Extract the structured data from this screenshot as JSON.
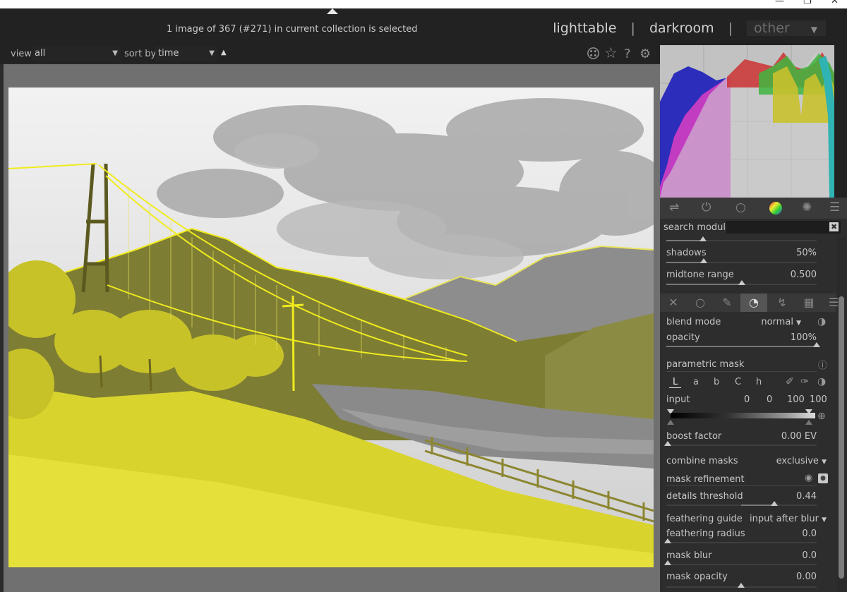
{
  "window": {
    "minimize": "—",
    "maximize": "❐",
    "close": "✕"
  },
  "header": {
    "selection_status": "1 image of 367 (#271) in current collection is selected",
    "views": {
      "lighttable": "lighttable",
      "darkroom": "darkroom",
      "other": "other",
      "separator": "|"
    }
  },
  "filterbar": {
    "view_label": "view",
    "view_value": "all",
    "sort_label": "sort by",
    "sort_value": "time",
    "sort_direction": "▲"
  },
  "modules": {
    "search_label": "search module",
    "search_value": ""
  },
  "tone_params": [
    {
      "label": "shadows",
      "value": "50%",
      "level": 0.25
    },
    {
      "label": "midtone range",
      "value": "0.500",
      "level": 0.5
    }
  ],
  "blend": {
    "mode_label": "blend mode",
    "mode_value": "normal",
    "opacity_label": "opacity",
    "opacity_value": "100%",
    "opacity_level": 1.0,
    "parametric_label": "parametric mask",
    "channels": [
      "L",
      "a",
      "b",
      "C",
      "h"
    ],
    "input_label": "input",
    "input_values": [
      "0",
      "0",
      "100",
      "100"
    ],
    "boost_label": "boost factor",
    "boost_value": "0.00 EV",
    "combine_label": "combine masks",
    "combine_value": "exclusive",
    "refinement_label": "mask refinement",
    "details_label": "details threshold",
    "details_value": "0.44",
    "feather_guide_label": "feathering guide",
    "feather_guide_value": "input after blur",
    "feather_radius_label": "feathering radius",
    "feather_radius_value": "0.0",
    "mask_blur_label": "mask blur",
    "mask_blur_value": "0.0",
    "mask_opacity_label": "mask opacity",
    "mask_opacity_value": "0.00"
  },
  "colors": {
    "mask_yellow": "#f0eb1e",
    "panel_bg": "#2d2d2d",
    "center_bg": "#707070"
  }
}
